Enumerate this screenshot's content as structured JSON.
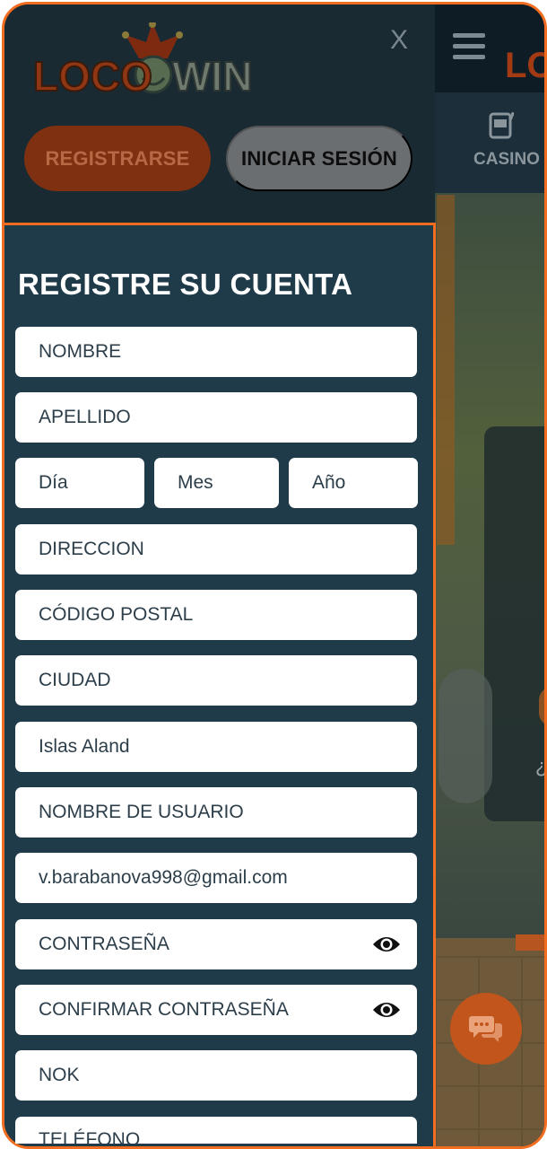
{
  "header": {
    "logo_text_loco": "LOCO",
    "logo_text_win": "WIN",
    "close_label": "X",
    "register_label": "REGISTRARSE",
    "login_label": "INICIAR SESIÓN"
  },
  "background_site": {
    "nav_casino_label": "CASINO",
    "partial_text": "¿"
  },
  "form": {
    "title": "REGISTRE SU CUENTA",
    "first_name": "NOMBRE",
    "last_name": "APELLIDO",
    "day": "Día",
    "month": "Mes",
    "year": "Año",
    "address": "DIRECCION",
    "postal_code": "CÓDIGO POSTAL",
    "city": "CIUDAD",
    "country": "Islas Aland",
    "username": "NOMBRE DE USUARIO",
    "email": "v.barabanova998@gmail.com",
    "password": "CONTRASEÑA",
    "confirm_password": "CONFIRMAR CONTRASEÑA",
    "currency": "NOK",
    "phone": "TELÉFONO"
  },
  "colors": {
    "accent": "#f26d1f",
    "panel": "#1f3a48",
    "header": "#1a2a33"
  }
}
